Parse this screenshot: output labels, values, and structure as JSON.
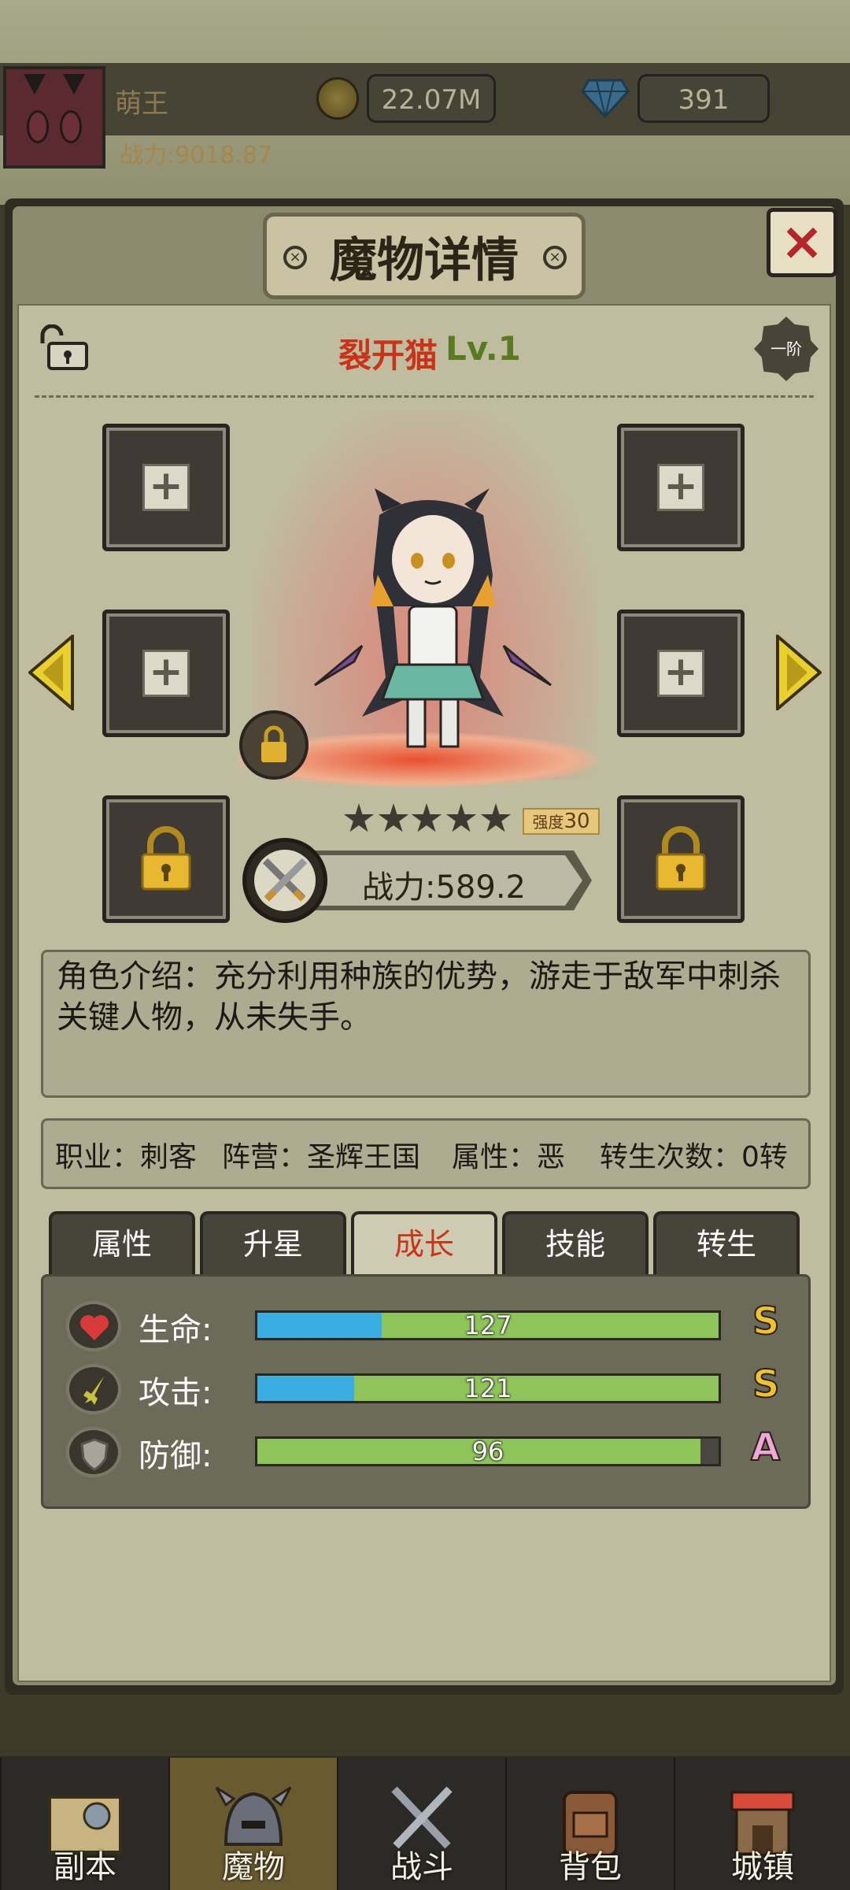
{
  "header": {
    "player_name": "萌王",
    "power": "战力:9018.87",
    "gold": "22.07M",
    "gems": "391"
  },
  "panel": {
    "title": "魔物详情",
    "close_label": "×"
  },
  "monster": {
    "name": "裂开猫",
    "level": "Lv.1",
    "tier": "一阶",
    "stars": 5,
    "strength_label": "强度",
    "strength_value": "30",
    "combat_power": "战力:589.2",
    "description": "角色介绍：充分利用种族的优势，游走于敌军中刺杀关键人物，从未失手。",
    "info": {
      "class": "职业：刺客",
      "faction": "阵营：圣辉王国",
      "attribute": "属性：恶",
      "rebirth": "转生次数：0转"
    }
  },
  "equipment_slots": {
    "plus": "+",
    "count_open": 4,
    "count_locked": 2
  },
  "tabs": [
    {
      "label": "属性",
      "active": false
    },
    {
      "label": "升星",
      "active": false
    },
    {
      "label": "成长",
      "active": true
    },
    {
      "label": "技能",
      "active": false
    },
    {
      "label": "转生",
      "active": false
    }
  ],
  "growth": [
    {
      "label": "生命:",
      "value": "127",
      "blue_fraction": 0.27,
      "green_fraction": 1.0,
      "grade": "S",
      "grade_color": "#f0c232",
      "icon": "heart-icon"
    },
    {
      "label": "攻击:",
      "value": "121",
      "blue_fraction": 0.21,
      "green_fraction": 1.0,
      "grade": "S",
      "grade_color": "#f0c232",
      "icon": "sword-icon"
    },
    {
      "label": "防御:",
      "value": "96",
      "blue_fraction": 0.0,
      "green_fraction": 0.96,
      "grade": "A",
      "grade_color": "#f0a8d8",
      "icon": "shield-icon"
    }
  ],
  "nav": [
    {
      "label": "副本",
      "icon": "map-icon",
      "active": false
    },
    {
      "label": "魔物",
      "icon": "helmet-icon",
      "active": true
    },
    {
      "label": "战斗",
      "icon": "crossed-swords-icon",
      "active": false
    },
    {
      "label": "背包",
      "icon": "backpack-icon",
      "active": false
    },
    {
      "label": "城镇",
      "icon": "shop-icon",
      "active": false
    }
  ],
  "colors": {
    "accent_red": "#c8341a",
    "level_green": "#5a7a22",
    "bar_blue": "#3aaee0",
    "bar_green": "#8fc45a"
  }
}
